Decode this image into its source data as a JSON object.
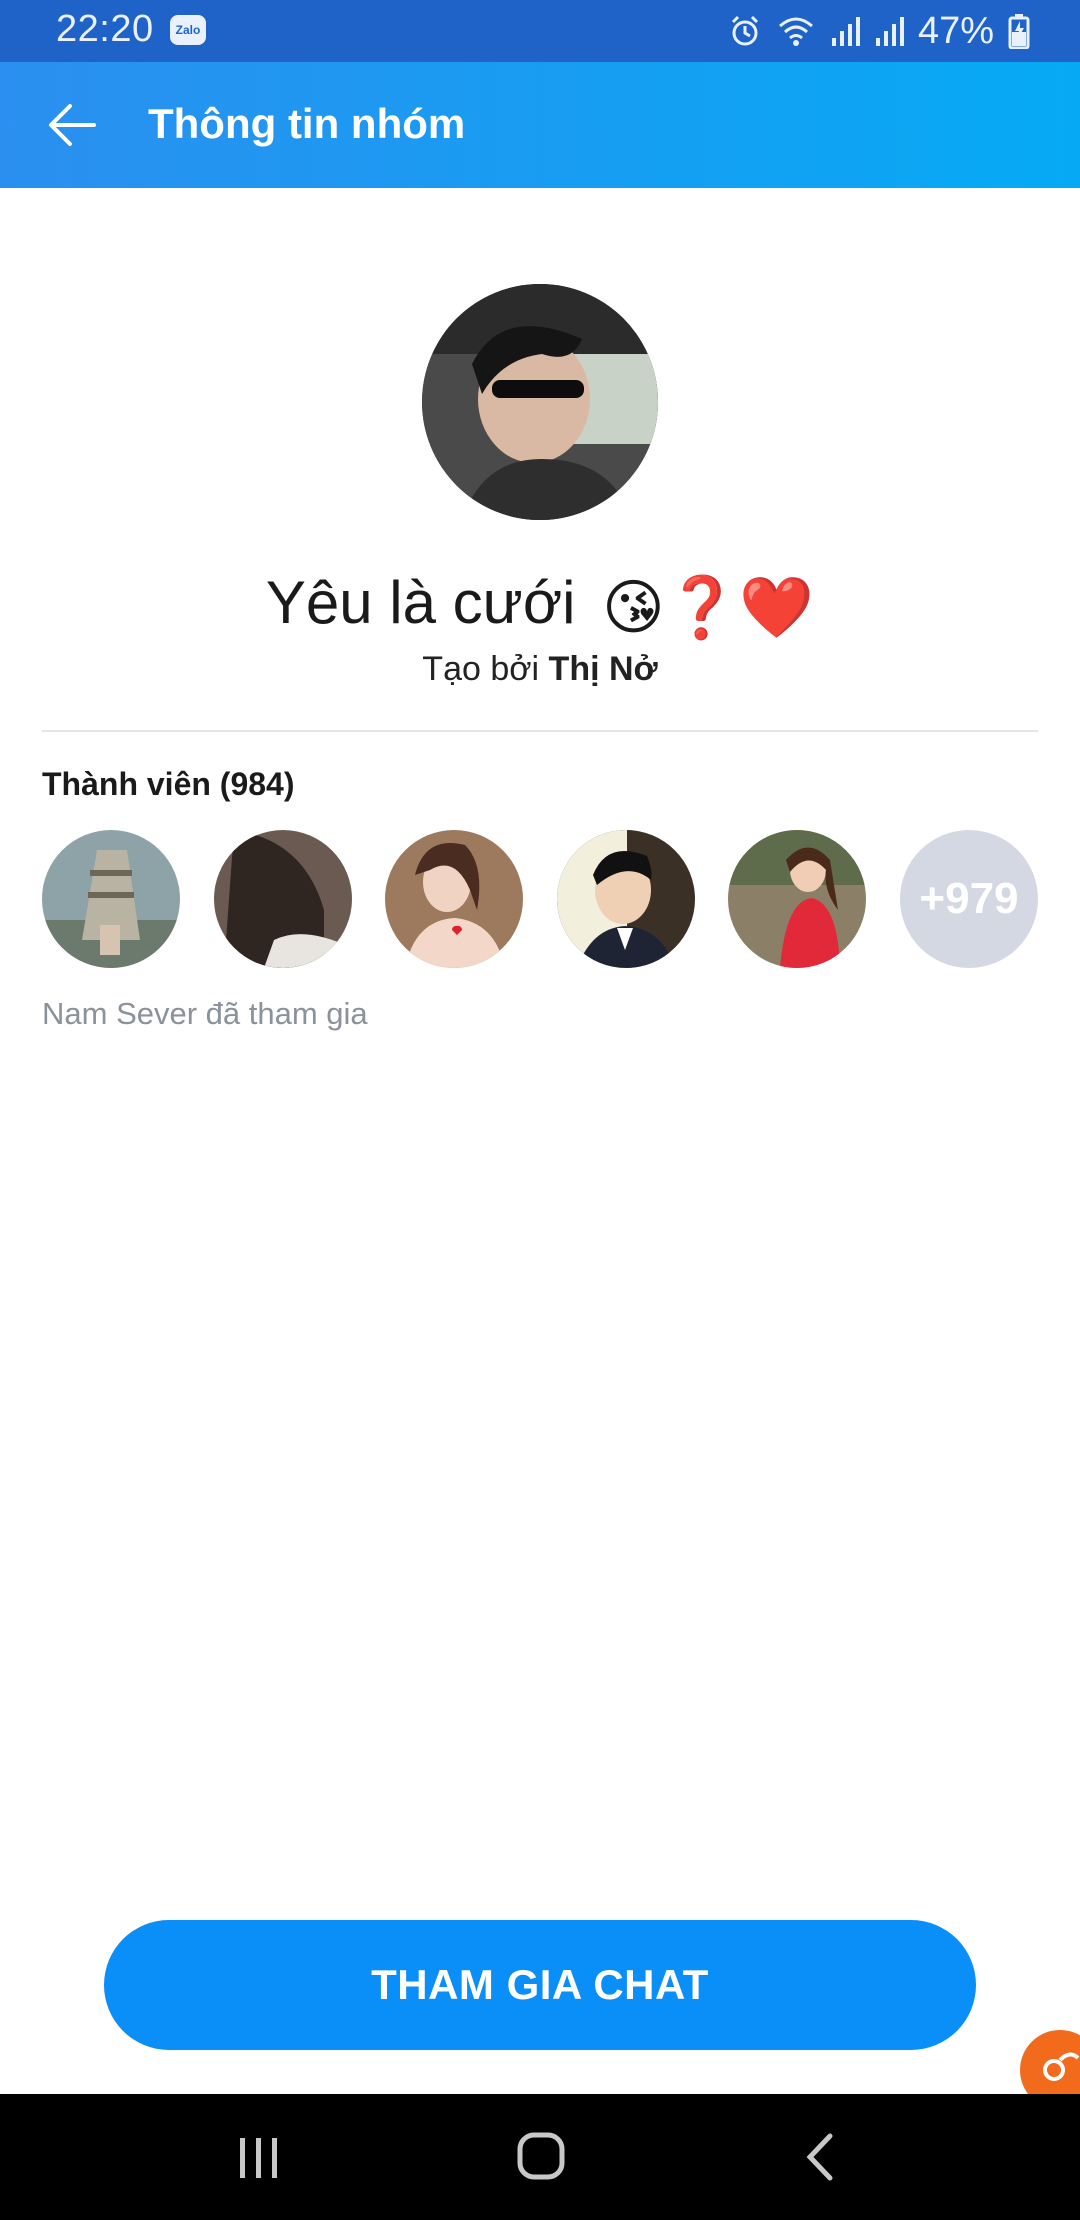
{
  "status_bar": {
    "time": "22:20",
    "app_badge": "Zalo",
    "battery": "47%",
    "icons": [
      "alarm-icon",
      "wifi-icon",
      "signal-icon",
      "signal-icon",
      "battery-icon"
    ]
  },
  "header": {
    "title": "Thông tin nhóm",
    "back_icon": "arrow-left-icon"
  },
  "group": {
    "name": "Yêu là cưới",
    "name_emojis": "😘❓❤️",
    "created_prefix": "Tạo bởi",
    "creator": "Thị Nở"
  },
  "members": {
    "label": "Thành viên (984)",
    "more_count": "+979",
    "joined_notice": "Nam Sever đã tham gia"
  },
  "actions": {
    "join_label": "THAM GIA CHAT"
  },
  "colors": {
    "status_bar": "#1f62c8",
    "header_gradient_start": "#2b8ff0",
    "header_gradient_end": "#06aaf4",
    "primary_button": "#0a8ef8",
    "more_avatar": "#d3d8e3"
  }
}
